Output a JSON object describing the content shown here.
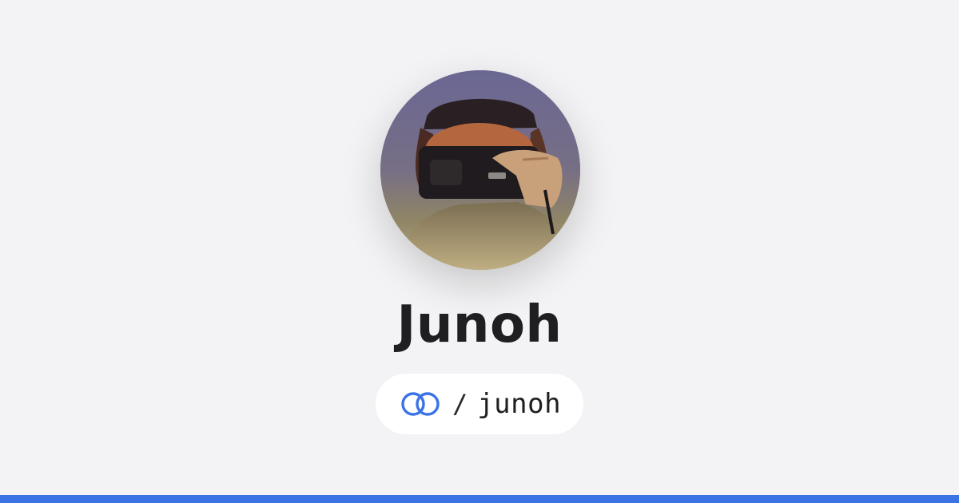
{
  "profile": {
    "display_name": "Junoh",
    "handle_separator": "/",
    "handle": "junoh",
    "avatar_icon": "profile-photo",
    "logo_icon": "interlocked-rings-logo"
  },
  "colors": {
    "background": "#f3f3f5",
    "accent": "#3b73e6",
    "text": "#1f1f22",
    "pill": "#ffffff"
  }
}
